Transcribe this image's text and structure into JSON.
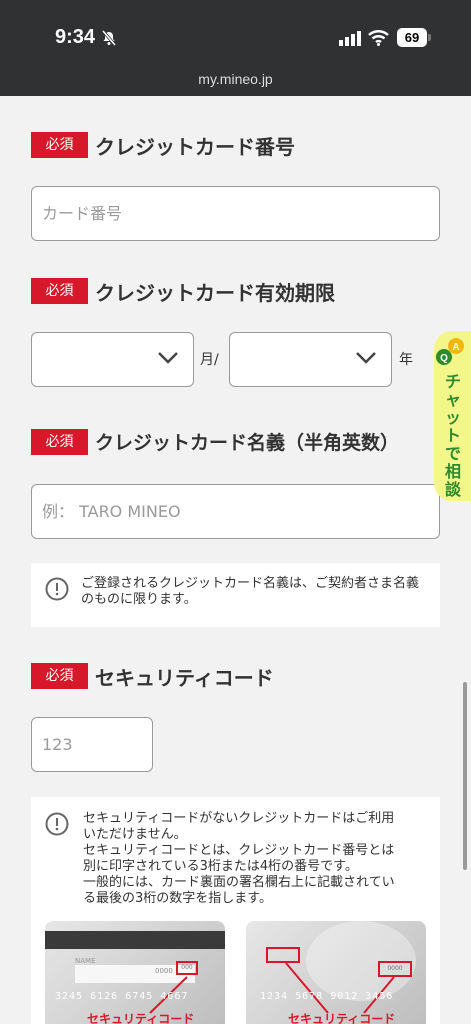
{
  "status_bar": {
    "time": "9:34",
    "battery": "69",
    "url": "my.mineo.jp"
  },
  "required_badge": "必須",
  "card_number": {
    "label": "クレジットカード番号",
    "placeholder": "カード番号"
  },
  "expiry": {
    "label": "クレジットカード有効期限",
    "month_unit": "月/",
    "year_unit": "年"
  },
  "name": {
    "label": "クレジットカード名義（半角英数）",
    "placeholder": "例： TARO MINEO",
    "notice": "ご登録されるクレジットカード名義は、ご契約者さま名義のものに限ります。"
  },
  "security": {
    "label": "セキュリティコード",
    "placeholder": "123",
    "notice_lines": [
      "セキュリティコードがないクレジットカードはご利用",
      "いただけません。",
      "セキュリティコードとは、クレジットカード番号とは",
      "別に印字されている3桁または4桁の番号です。",
      "一般的には、カード裏面の署名欄右上に記載されてい",
      "る最後の3桁の数字を指します。"
    ],
    "card_back": {
      "name_text": "NAME",
      "code_text": "000",
      "number_text": "3245 6126 6745 4667",
      "label": "セキュリティコード"
    },
    "card_front": {
      "code_text": "0000",
      "number_text": "1234 5678 9012 3456",
      "label": "セキュリティコード"
    }
  },
  "chat": {
    "text": "チャットで相談",
    "icon_letters": {
      "top": "A",
      "bottom": "Q"
    }
  },
  "colors": {
    "required": "#d7182a",
    "status_bar": "#2f3133",
    "chat_bg": "#f3f78a",
    "chat_text": "#2d8a2d"
  }
}
